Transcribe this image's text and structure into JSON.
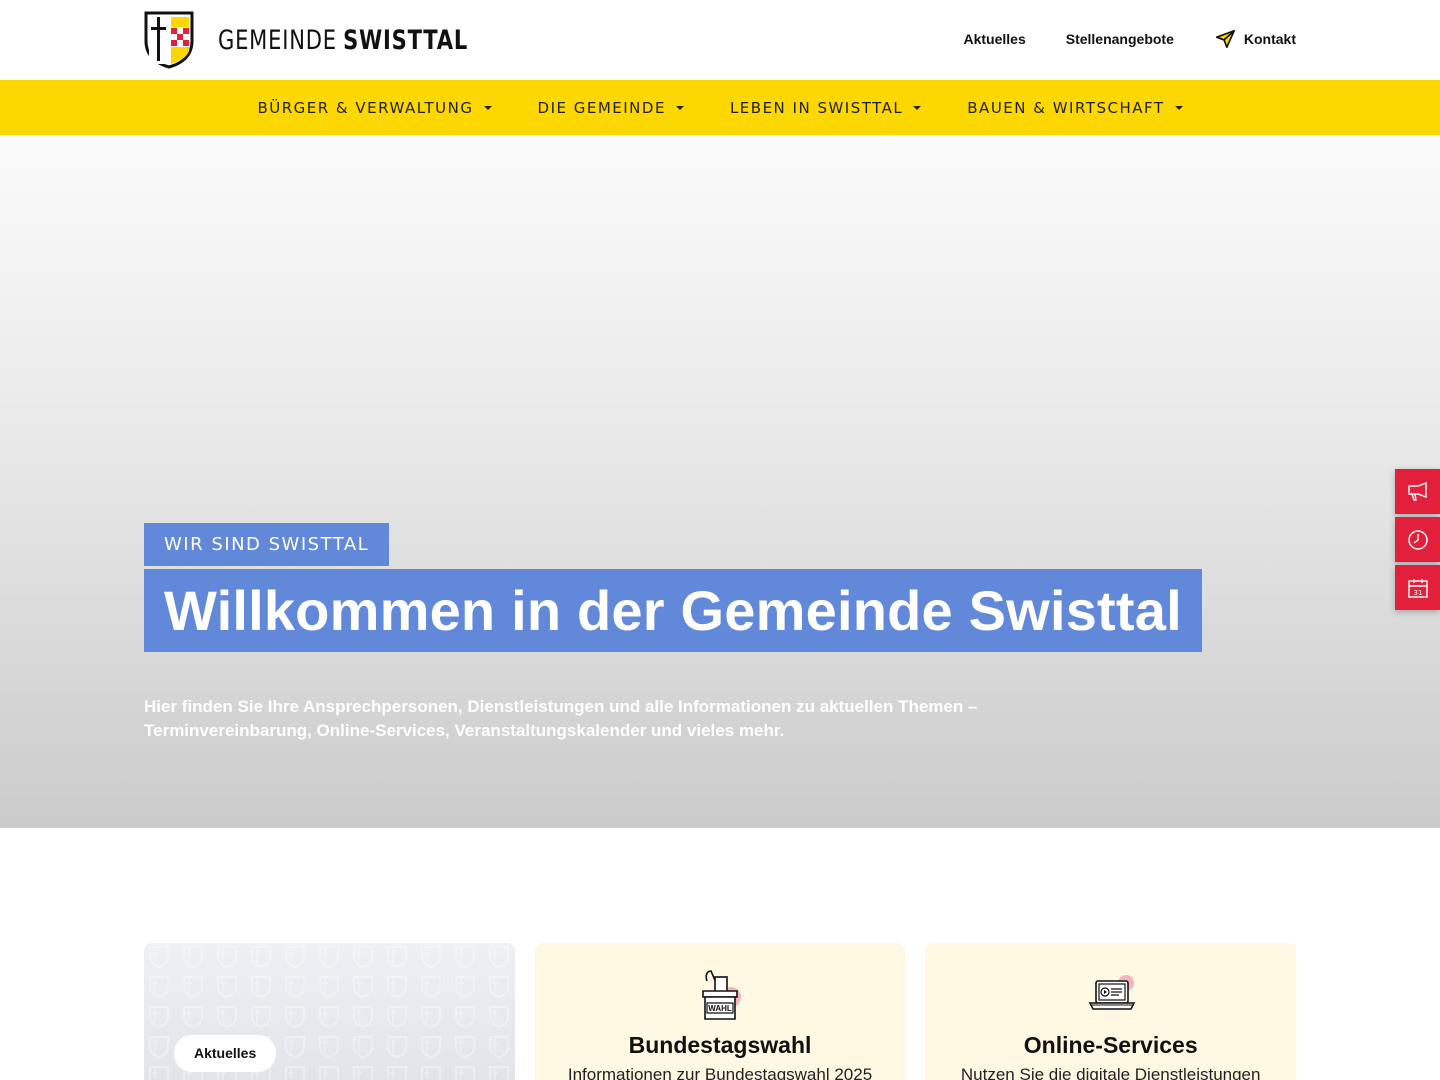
{
  "header": {
    "logo_light": "GEMEINDE",
    "logo_bold": "SWISTTAL",
    "top_links": [
      "Aktuelles",
      "Stellenangebote",
      "Kontakt"
    ]
  },
  "nav": {
    "items": [
      "Bürger & Verwaltung",
      "Die Gemeinde",
      "Leben in Swisttal",
      "Bauen & Wirtschaft"
    ]
  },
  "hero": {
    "kicker": "Wir sind Swisttal",
    "title": "Willkommen in der Gemeinde Swisttal",
    "text": "Hier finden Sie Ihre Ansprechpersonen, Dienstleistungen und alle Informationen zu aktuellen Themen – Terminvereinbarung, Online-Services, Veranstaltungskalender und vieles mehr."
  },
  "side_tabs": {
    "icons": [
      "megaphone-icon",
      "clock-icon",
      "calendar-icon"
    ],
    "calendar_day": "31"
  },
  "cards": [
    {
      "badge": "Aktuelles"
    },
    {
      "icon": "ballot-box-icon",
      "icon_label": "WAHL",
      "title": "Bundestagswahl",
      "text": "Informationen zur Bundestagswahl 2025"
    },
    {
      "icon": "laptop-video-icon",
      "title": "Online-Services",
      "text": "Nutzen Sie die digitale Dienstleistungen"
    }
  ],
  "colors": {
    "yellow": "#fdd700",
    "blue": "#6188d9",
    "red": "#e3203b",
    "card_bg": "#fff8e3"
  }
}
